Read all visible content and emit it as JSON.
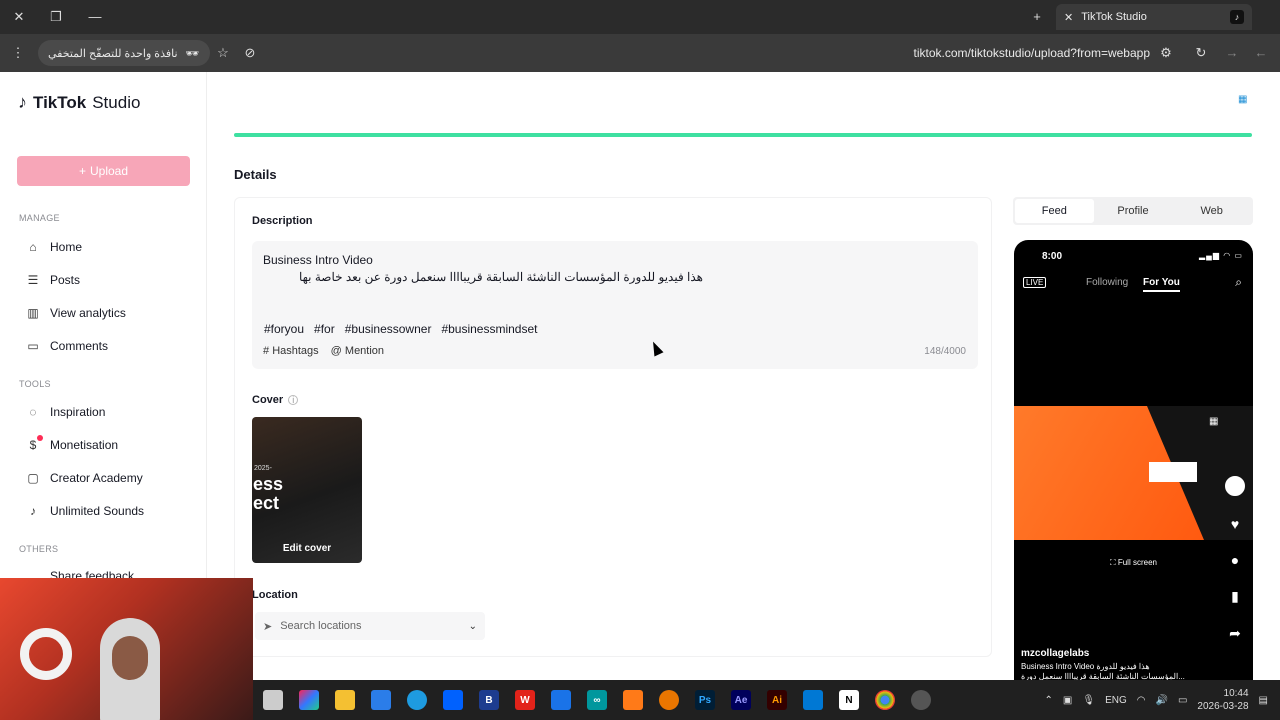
{
  "browser": {
    "tab_title": "TikTok Studio",
    "incognito_label": "نافذة واحدة للتصفّح المتخفي",
    "url": "tiktok.com/tiktokstudio/upload?from=webapp"
  },
  "sidebar": {
    "logo_brand": "TikTok",
    "logo_suffix": "Studio",
    "upload_label": "Upload",
    "section_manage": "MANAGE",
    "section_tools": "TOOLS",
    "section_others": "OTHERS",
    "items": [
      {
        "label": "Home",
        "icon": "home-icon"
      },
      {
        "label": "Posts",
        "icon": "list-icon"
      },
      {
        "label": "View analytics",
        "icon": "analytics-icon"
      },
      {
        "label": "Comments",
        "icon": "comment-icon"
      },
      {
        "label": "Inspiration",
        "icon": "lightbulb-icon"
      },
      {
        "label": "Monetisation",
        "icon": "dollar-icon"
      },
      {
        "label": "Creator Academy",
        "icon": "academy-icon"
      },
      {
        "label": "Unlimited Sounds",
        "icon": "music-icon"
      },
      {
        "label": "Share feedback",
        "icon": "feedback-icon"
      }
    ]
  },
  "main": {
    "details_heading": "Details",
    "description_label": "Description",
    "description_line1": "Business Intro Video",
    "description_line2": "هذا فيديو للدورة المؤسسات الناشئة السابقة قريباااا سنعمل دورة عن بعد خاصة بها",
    "hashtags": [
      "#foryou",
      "#for",
      "#businessowner",
      "#businessmindset"
    ],
    "tool_hashtags": "Hashtags",
    "tool_mention": "Mention",
    "char_count": "148/4000",
    "cover_label": "Cover",
    "cover_year": "2025-",
    "cover_text_1": "ess",
    "cover_text_2": "ect",
    "edit_cover": "Edit cover",
    "location_label": "Location",
    "location_placeholder": "Search locations"
  },
  "preview": {
    "tabs": [
      "Feed",
      "Profile",
      "Web"
    ],
    "active_tab": "Feed",
    "time": "8:00",
    "live": "LIVE",
    "following": "Following",
    "for_you": "For You",
    "full_screen": "Full screen",
    "username": "mzcollagelabs",
    "caption_line1": "Business Intro Video هذا فيديو للدورة",
    "caption_line2": "المؤسسات الناشئة السابقة قريباااا سنعمل دورة..."
  },
  "taskbar": {
    "lang": "ENG",
    "time": "10:44",
    "date": "2026-03-28"
  },
  "colors": {
    "upload_button": "#f7a6b8",
    "progress": "#3ee0a1",
    "accent": "#fe2c55"
  }
}
